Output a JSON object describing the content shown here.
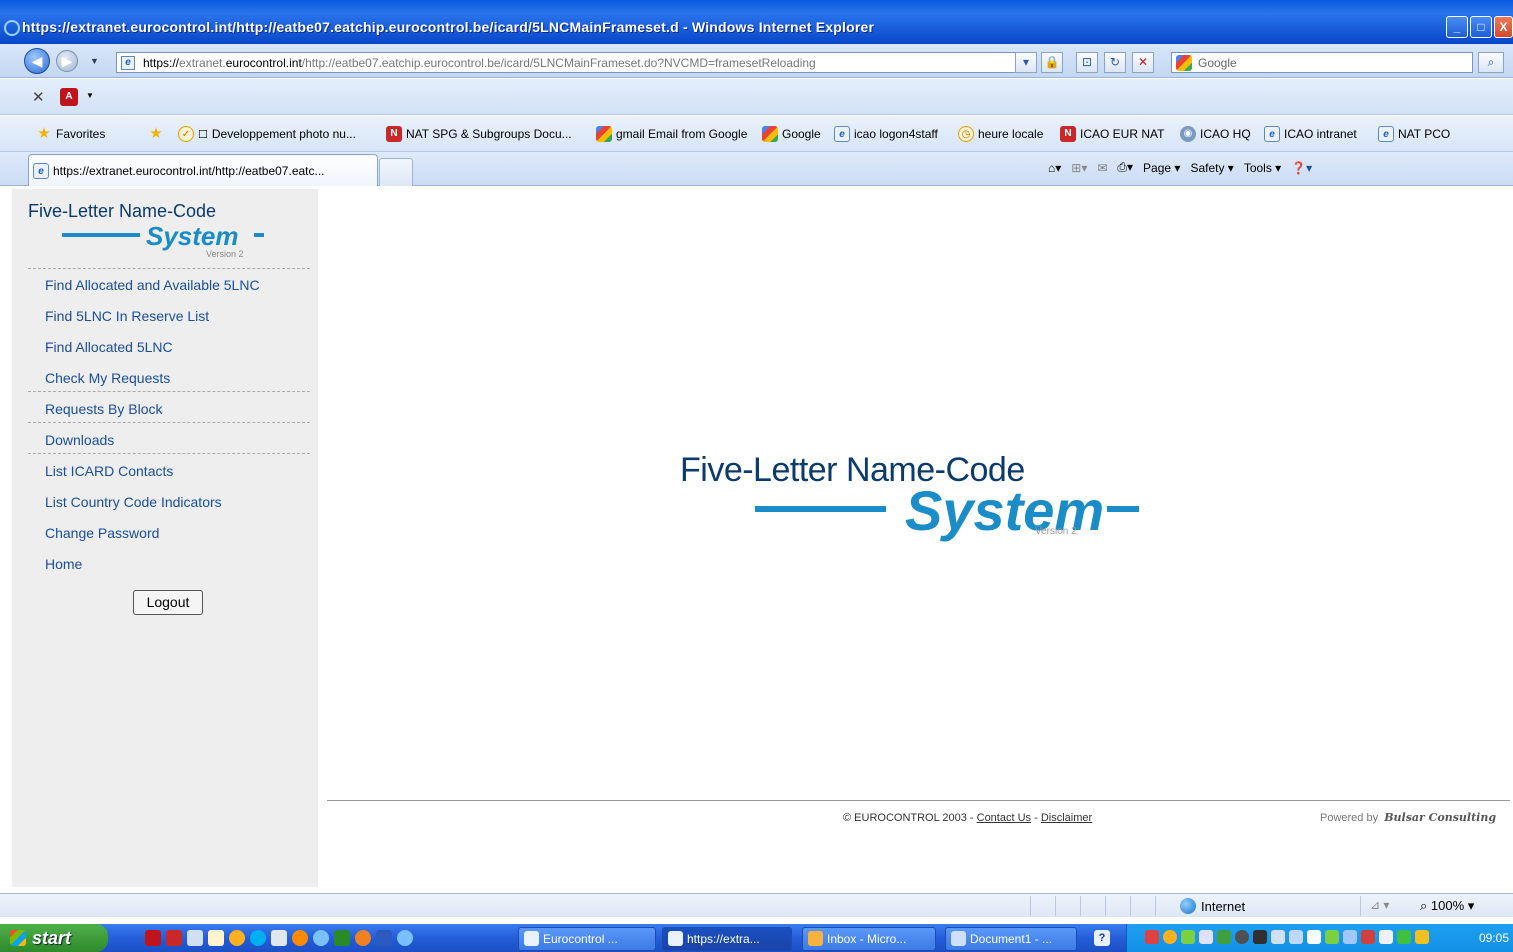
{
  "browser": {
    "window_title": "https://extranet.eurocontrol.int/http://eatbe07.eatchip.eurocontrol.be/icard/5LNCMainFrameset.d - Windows Internet Explorer",
    "address_protocol": "https://",
    "address_domain_pre": "extranet.",
    "address_domain": "eurocontrol.int",
    "address_rest": "/http://eatbe07.eatchip.eurocontrol.be/icard/5LNCMainFrameset.do?NVCMD=framesetReloading",
    "search_placeholder": "Google",
    "favorites_label": "Favorites",
    "favorites": [
      {
        "label": "Developpement photo nu...",
        "icon": "photo-icon"
      },
      {
        "label": "NAT SPG & Subgroups Docu...",
        "icon": "nat-icon"
      },
      {
        "label": "gmail Email from Google",
        "icon": "google-icon"
      },
      {
        "label": "Google",
        "icon": "google-icon"
      },
      {
        "label": "icao logon4staff",
        "icon": "ie-icon"
      },
      {
        "label": "heure locale",
        "icon": "clock-icon"
      },
      {
        "label": "ICAO EUR NAT",
        "icon": "nat-icon"
      },
      {
        "label": "ICAO HQ",
        "icon": "icao-icon"
      },
      {
        "label": "ICAO intranet",
        "icon": "ie-icon"
      },
      {
        "label": "NAT PCO",
        "icon": "ie-icon"
      }
    ],
    "tab_title": "https://extranet.eurocontrol.int/http://eatbe07.eatc...",
    "commands": {
      "page": "Page",
      "safety": "Safety",
      "tools": "Tools"
    },
    "status_zone": "Internet",
    "zoom": "100%"
  },
  "app": {
    "logo_title": "Five-Letter Name-Code",
    "logo_system": "System",
    "logo_version": "Version 2",
    "menu": [
      "Find Allocated and Available 5LNC",
      "Find 5LNC In Reserve List",
      "Find Allocated 5LNC",
      "Check My Requests",
      "Requests By Block",
      "Downloads",
      "List ICARD Contacts",
      "List Country Code Indicators",
      "Change Password",
      "Home"
    ],
    "logout_label": "Logout",
    "footer_copyright": "© EUROCONTROL 2003 -",
    "footer_contact": "Contact Us",
    "footer_sep": "-",
    "footer_disclaimer": "Disclaimer",
    "powered_label": "Powered by",
    "powered_brand": "Bulsar Consulting"
  },
  "taskbar": {
    "start_label": "start",
    "tasks": [
      "Eurocontrol ...",
      "https://extra...",
      "Inbox - Micro...",
      "Document1 - ..."
    ],
    "clock": "09:05"
  }
}
